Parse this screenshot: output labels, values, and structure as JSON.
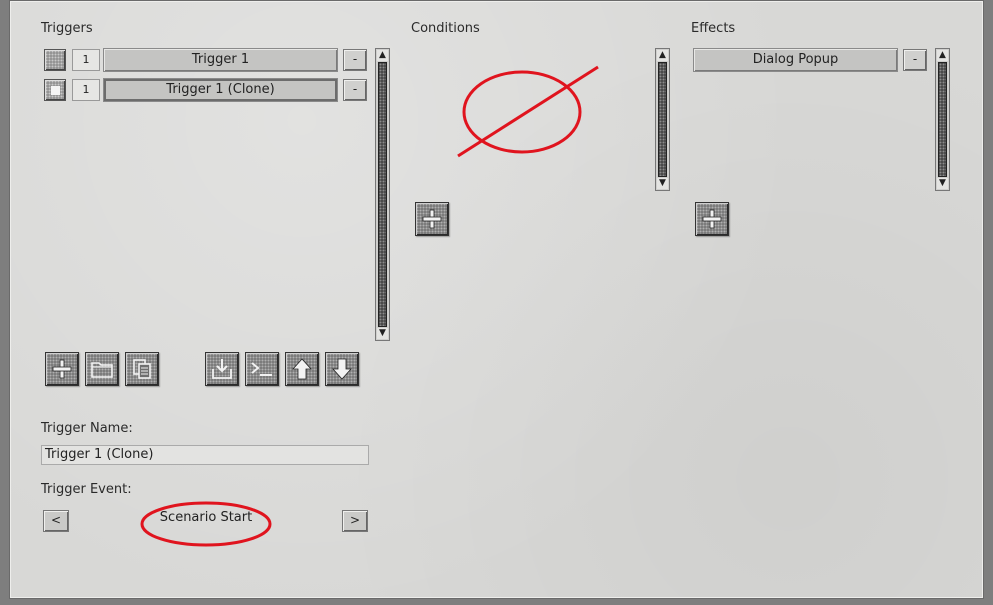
{
  "triggers": {
    "title": "Triggers",
    "items": [
      {
        "number": "1",
        "name": "Trigger 1",
        "remove_label": "-"
      },
      {
        "number": "1",
        "name": "Trigger 1 (Clone)",
        "remove_label": "-"
      }
    ],
    "toolbar_icons": [
      "add-icon",
      "folder-icon",
      "copy-icon",
      "import-icon",
      "console-icon",
      "move-up-icon",
      "move-down-icon"
    ]
  },
  "conditions": {
    "title": "Conditions"
  },
  "effects": {
    "title": "Effects",
    "items": [
      {
        "name": "Dialog Popup",
        "remove_label": "-"
      }
    ]
  },
  "trigger_name": {
    "label": "Trigger Name:",
    "value": "Trigger 1 (Clone)"
  },
  "trigger_event": {
    "label": "Trigger Event:",
    "prev_label": "<",
    "next_label": ">",
    "value": "Scenario Start"
  },
  "scroll": {
    "up": "▲",
    "down": "▼"
  },
  "colors": {
    "annotation": "#e0141e",
    "panel": "#d8d8d6"
  }
}
